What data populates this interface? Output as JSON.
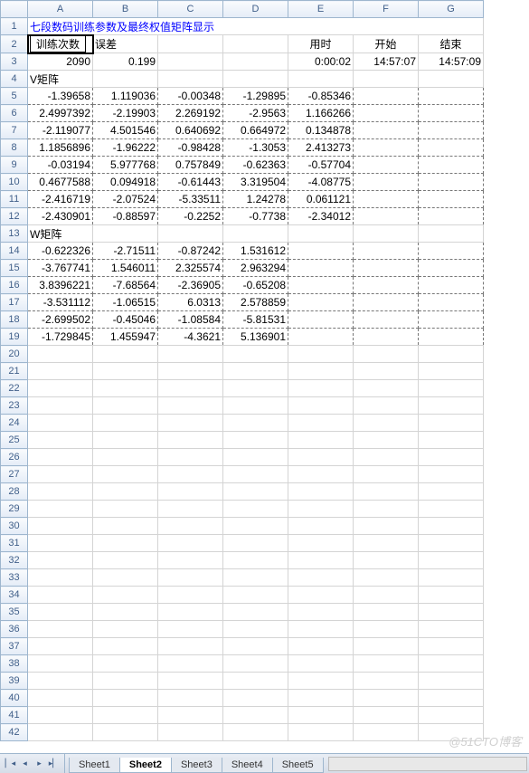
{
  "columns": [
    "A",
    "B",
    "C",
    "D",
    "E",
    "F",
    "G"
  ],
  "rows": 42,
  "title_link": "七段数码训练参数及最终权值矩阵显示",
  "header_row": {
    "a": "训练次数",
    "b": "误差",
    "e": "用时",
    "f": "开始",
    "g": "结束"
  },
  "value_row": {
    "a": "2090",
    "b": "0.199",
    "e": "0:00:02",
    "f": "14:57:07",
    "g": "14:57:09"
  },
  "v_label": "V矩阵",
  "w_label": "W矩阵",
  "chart_data": {
    "type": "table",
    "v_matrix": [
      [
        "-1.39658",
        "1.119036",
        "-0.00348",
        "-1.29895",
        "-0.85346"
      ],
      [
        "2.4997392",
        "-2.19903",
        "2.269192",
        "-2.9563",
        "1.166266"
      ],
      [
        "-2.119077",
        "4.501546",
        "0.640692",
        "0.664972",
        "0.134878"
      ],
      [
        "1.1856896",
        "-1.96222",
        "-0.98428",
        "-1.3053",
        "2.413273"
      ],
      [
        "-0.03194",
        "5.977768",
        "0.757849",
        "-0.62363",
        "-0.57704"
      ],
      [
        "0.4677588",
        "0.094918",
        "-0.61443",
        "3.319504",
        "-4.08775"
      ],
      [
        "-2.416719",
        "-2.07524",
        "-5.33511",
        "1.24278",
        "0.061121"
      ],
      [
        "-2.430901",
        "-0.88597",
        "-0.2252",
        "-0.7738",
        "-2.34012"
      ]
    ],
    "w_matrix": [
      [
        "-0.622326",
        "-2.71511",
        "-0.87242",
        "1.531612"
      ],
      [
        "-3.767741",
        "1.546011",
        "2.325574",
        "2.963294"
      ],
      [
        "3.8396221",
        "-7.68564",
        "-2.36905",
        "-0.65208"
      ],
      [
        "-3.531112",
        "-1.06515",
        "6.0313",
        "2.578859"
      ],
      [
        "-2.699502",
        "-0.45046",
        "-1.08584",
        "-5.81531"
      ],
      [
        "-1.729845",
        "1.455947",
        "-4.3621",
        "5.136901"
      ]
    ]
  },
  "tabs": [
    "Sheet1",
    "Sheet2",
    "Sheet3",
    "Sheet4",
    "Sheet5"
  ],
  "active_tab": 1,
  "nav": {
    "first": "▏◂",
    "prev": "◂",
    "next": "▸",
    "last": "▸▏"
  },
  "watermark": "@51CTO博客"
}
